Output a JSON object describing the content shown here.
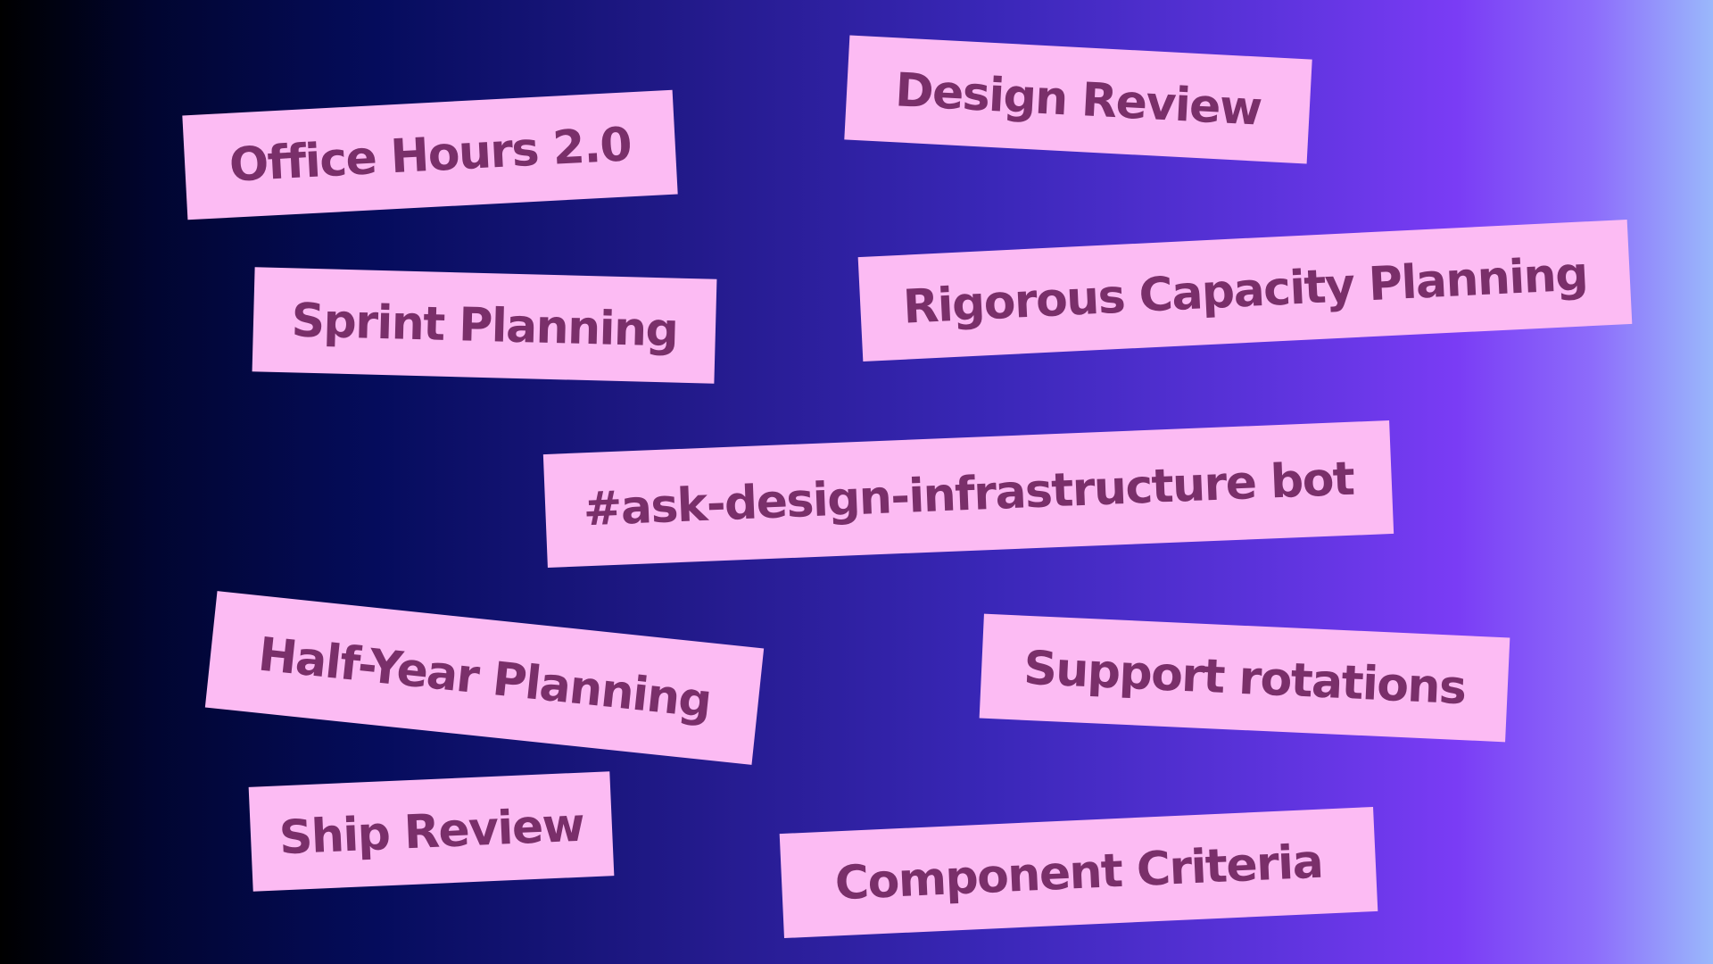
{
  "background": {
    "gradient_colors": [
      "#000000",
      "#050c5c",
      "#3a27b8",
      "#7a3cf5",
      "#9ab8fb"
    ]
  },
  "tag_style": {
    "fill_color": "#fcbbf3",
    "text_color": "#7a2f6a"
  },
  "tags": [
    {
      "label": "Office Hours 2.0"
    },
    {
      "label": "Design Review"
    },
    {
      "label": "Sprint Planning"
    },
    {
      "label": "Rigorous Capacity Planning"
    },
    {
      "label": "#ask-design-infrastructure bot"
    },
    {
      "label": "Half-Year Planning"
    },
    {
      "label": "Support rotations"
    },
    {
      "label": "Ship Review"
    },
    {
      "label": "Component Criteria"
    }
  ]
}
